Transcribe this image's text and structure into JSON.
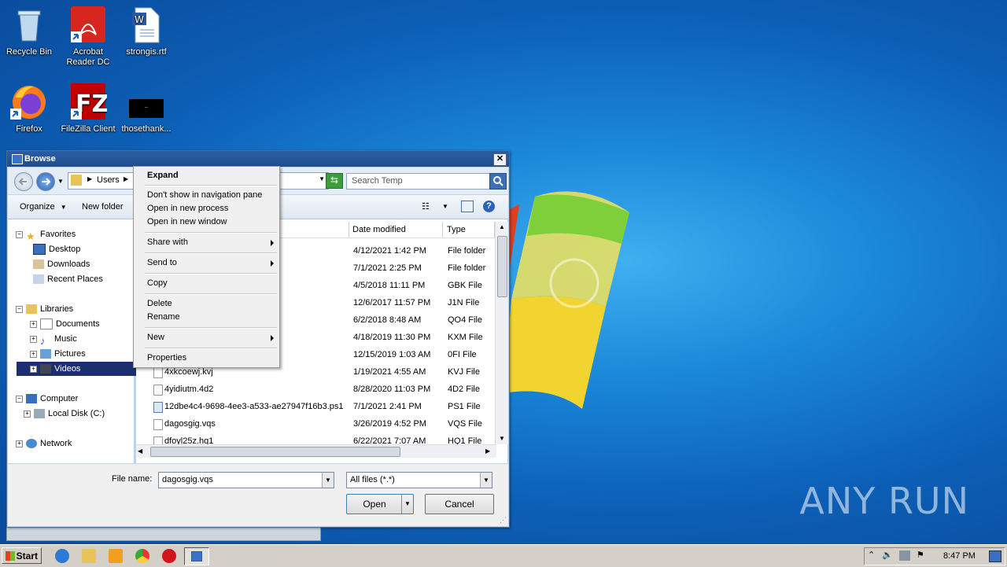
{
  "desktop": {
    "icons": [
      {
        "label": "Recycle Bin"
      },
      {
        "label": "Acrobat Reader DC"
      },
      {
        "label": "strongis.rtf"
      },
      {
        "label": "Firefox"
      },
      {
        "label": "FileZilla Client"
      },
      {
        "label": "thosethank..."
      }
    ],
    "watermark": "ANY RUN"
  },
  "dialog": {
    "title": "Browse",
    "address": {
      "crumbs": [
        "Users"
      ]
    },
    "search_placeholder": "Search Temp",
    "toolbar": {
      "organize": "Organize",
      "new_folder": "New folder"
    },
    "nav": {
      "favorites": "Favorites",
      "desktop": "Desktop",
      "downloads": "Downloads",
      "recent_places": "Recent Places",
      "libraries": "Libraries",
      "documents": "Documents",
      "music": "Music",
      "pictures": "Pictures",
      "videos": "Videos",
      "computer": "Computer",
      "local_disk": "Local Disk (C:)",
      "network": "Network"
    },
    "columns": {
      "date_modified": "Date modified",
      "type": "Type"
    },
    "files": [
      {
        "name": "",
        "date": "4/12/2021 1:42 PM",
        "type": "File folder"
      },
      {
        "name": "",
        "date": "7/1/2021 2:25 PM",
        "type": "File folder"
      },
      {
        "name": "",
        "date": "4/5/2018 11:11 PM",
        "type": "GBK File"
      },
      {
        "name": "",
        "date": "12/6/2017 11:57 PM",
        "type": "J1N File"
      },
      {
        "name": "",
        "date": "6/2/2018 8:48 AM",
        "type": "QO4 File"
      },
      {
        "name": "",
        "date": "4/18/2019 11:30 PM",
        "type": "KXM File"
      },
      {
        "name": "",
        "date": "12/15/2019 1:03 AM",
        "type": "0FI File"
      },
      {
        "name": "4xkcoewj.kvj",
        "date": "1/19/2021 4:55 AM",
        "type": "KVJ File"
      },
      {
        "name": "4yidiutm.4d2",
        "date": "8/28/2020 11:03 PM",
        "type": "4D2 File"
      },
      {
        "name": "12dbe4c4-9698-4ee3-a533-ae27947f16b3.ps1",
        "date": "7/1/2021 2:41 PM",
        "type": "PS1 File"
      },
      {
        "name": "dagosgig.vqs",
        "date": "3/26/2019 4:52 PM",
        "type": "VQS File"
      },
      {
        "name": "dfoyl25z.hq1",
        "date": "6/22/2021 7:07 AM",
        "type": "HQ1 File"
      }
    ],
    "filename_label": "File name:",
    "filename_value": "dagosgig.vqs",
    "filter_value": "All files (*.*)",
    "open_label": "Open",
    "cancel_label": "Cancel"
  },
  "context_menu": {
    "expand": "Expand",
    "dont_show": "Don't show in navigation pane",
    "open_new_process": "Open in new process",
    "open_new_window": "Open in new window",
    "share_with": "Share with",
    "send_to": "Send to",
    "copy": "Copy",
    "delete": "Delete",
    "rename": "Rename",
    "new": "New",
    "properties": "Properties"
  },
  "taskbar": {
    "start_label": "Start",
    "clock": "8:47 PM"
  }
}
